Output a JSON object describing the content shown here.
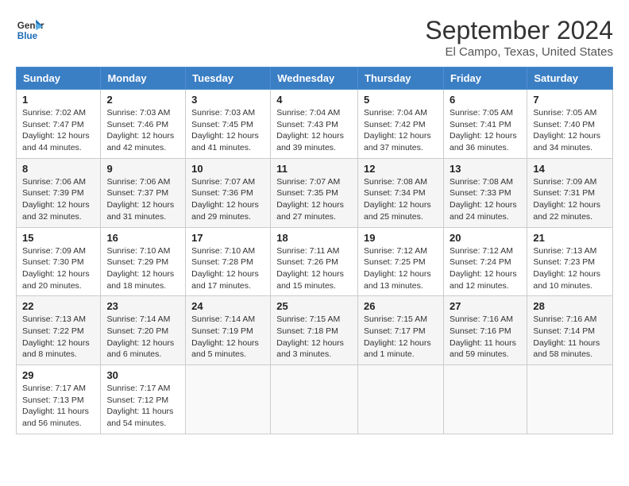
{
  "logo": {
    "line1": "General",
    "line2": "Blue"
  },
  "title": "September 2024",
  "location": "El Campo, Texas, United States",
  "days_of_week": [
    "Sunday",
    "Monday",
    "Tuesday",
    "Wednesday",
    "Thursday",
    "Friday",
    "Saturday"
  ],
  "weeks": [
    [
      {
        "day": "1",
        "sunrise": "7:02 AM",
        "sunset": "7:47 PM",
        "daylight": "12 hours and 44 minutes."
      },
      {
        "day": "2",
        "sunrise": "7:03 AM",
        "sunset": "7:46 PM",
        "daylight": "12 hours and 42 minutes."
      },
      {
        "day": "3",
        "sunrise": "7:03 AM",
        "sunset": "7:45 PM",
        "daylight": "12 hours and 41 minutes."
      },
      {
        "day": "4",
        "sunrise": "7:04 AM",
        "sunset": "7:43 PM",
        "daylight": "12 hours and 39 minutes."
      },
      {
        "day": "5",
        "sunrise": "7:04 AM",
        "sunset": "7:42 PM",
        "daylight": "12 hours and 37 minutes."
      },
      {
        "day": "6",
        "sunrise": "7:05 AM",
        "sunset": "7:41 PM",
        "daylight": "12 hours and 36 minutes."
      },
      {
        "day": "7",
        "sunrise": "7:05 AM",
        "sunset": "7:40 PM",
        "daylight": "12 hours and 34 minutes."
      }
    ],
    [
      {
        "day": "8",
        "sunrise": "7:06 AM",
        "sunset": "7:39 PM",
        "daylight": "12 hours and 32 minutes."
      },
      {
        "day": "9",
        "sunrise": "7:06 AM",
        "sunset": "7:37 PM",
        "daylight": "12 hours and 31 minutes."
      },
      {
        "day": "10",
        "sunrise": "7:07 AM",
        "sunset": "7:36 PM",
        "daylight": "12 hours and 29 minutes."
      },
      {
        "day": "11",
        "sunrise": "7:07 AM",
        "sunset": "7:35 PM",
        "daylight": "12 hours and 27 minutes."
      },
      {
        "day": "12",
        "sunrise": "7:08 AM",
        "sunset": "7:34 PM",
        "daylight": "12 hours and 25 minutes."
      },
      {
        "day": "13",
        "sunrise": "7:08 AM",
        "sunset": "7:33 PM",
        "daylight": "12 hours and 24 minutes."
      },
      {
        "day": "14",
        "sunrise": "7:09 AM",
        "sunset": "7:31 PM",
        "daylight": "12 hours and 22 minutes."
      }
    ],
    [
      {
        "day": "15",
        "sunrise": "7:09 AM",
        "sunset": "7:30 PM",
        "daylight": "12 hours and 20 minutes."
      },
      {
        "day": "16",
        "sunrise": "7:10 AM",
        "sunset": "7:29 PM",
        "daylight": "12 hours and 18 minutes."
      },
      {
        "day": "17",
        "sunrise": "7:10 AM",
        "sunset": "7:28 PM",
        "daylight": "12 hours and 17 minutes."
      },
      {
        "day": "18",
        "sunrise": "7:11 AM",
        "sunset": "7:26 PM",
        "daylight": "12 hours and 15 minutes."
      },
      {
        "day": "19",
        "sunrise": "7:12 AM",
        "sunset": "7:25 PM",
        "daylight": "12 hours and 13 minutes."
      },
      {
        "day": "20",
        "sunrise": "7:12 AM",
        "sunset": "7:24 PM",
        "daylight": "12 hours and 12 minutes."
      },
      {
        "day": "21",
        "sunrise": "7:13 AM",
        "sunset": "7:23 PM",
        "daylight": "12 hours and 10 minutes."
      }
    ],
    [
      {
        "day": "22",
        "sunrise": "7:13 AM",
        "sunset": "7:22 PM",
        "daylight": "12 hours and 8 minutes."
      },
      {
        "day": "23",
        "sunrise": "7:14 AM",
        "sunset": "7:20 PM",
        "daylight": "12 hours and 6 minutes."
      },
      {
        "day": "24",
        "sunrise": "7:14 AM",
        "sunset": "7:19 PM",
        "daylight": "12 hours and 5 minutes."
      },
      {
        "day": "25",
        "sunrise": "7:15 AM",
        "sunset": "7:18 PM",
        "daylight": "12 hours and 3 minutes."
      },
      {
        "day": "26",
        "sunrise": "7:15 AM",
        "sunset": "7:17 PM",
        "daylight": "12 hours and 1 minute."
      },
      {
        "day": "27",
        "sunrise": "7:16 AM",
        "sunset": "7:16 PM",
        "daylight": "11 hours and 59 minutes."
      },
      {
        "day": "28",
        "sunrise": "7:16 AM",
        "sunset": "7:14 PM",
        "daylight": "11 hours and 58 minutes."
      }
    ],
    [
      {
        "day": "29",
        "sunrise": "7:17 AM",
        "sunset": "7:13 PM",
        "daylight": "11 hours and 56 minutes."
      },
      {
        "day": "30",
        "sunrise": "7:17 AM",
        "sunset": "7:12 PM",
        "daylight": "11 hours and 54 minutes."
      },
      null,
      null,
      null,
      null,
      null
    ]
  ]
}
